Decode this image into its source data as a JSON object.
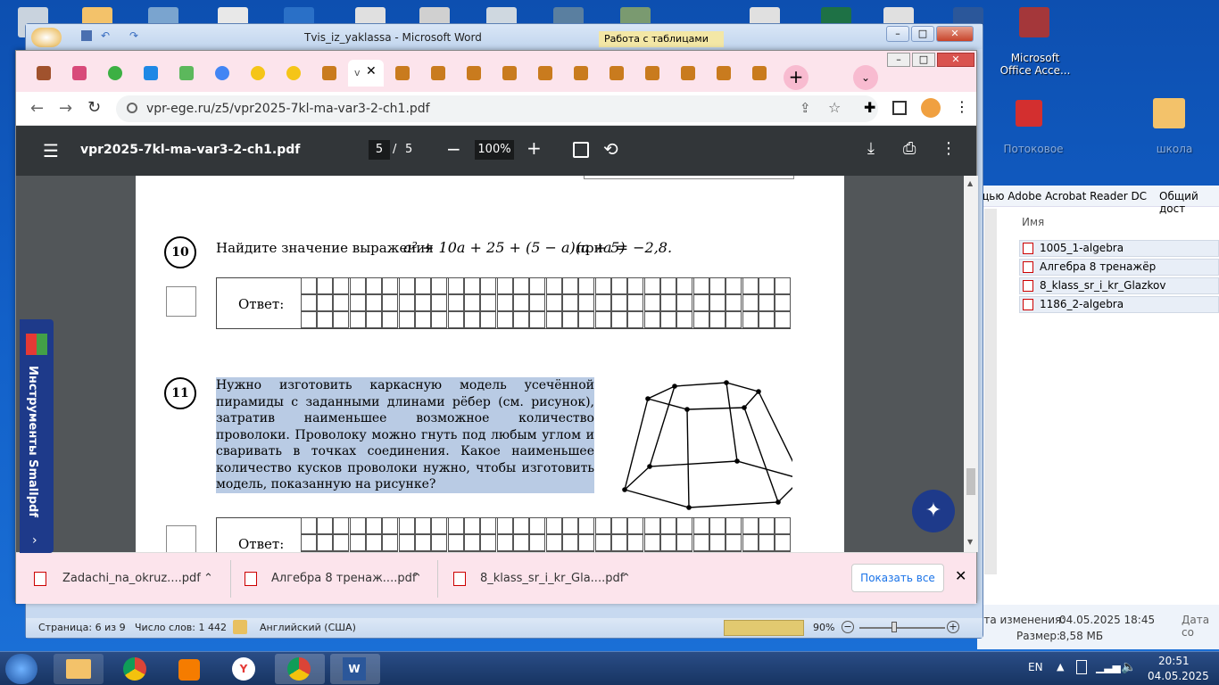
{
  "desktop": {
    "icons": [
      {
        "label": "Microsoft Office Acce..."
      },
      {
        "label": "Потоковое"
      },
      {
        "label": "школа"
      }
    ]
  },
  "word": {
    "title": "Tvis_iz_yaklassa - Microsoft Word",
    "context_tab": "Работа с таблицами",
    "status": {
      "page": "Страница: 6 из 9",
      "words": "Число слов: 1 442",
      "lang": "Английский (США)",
      "zoom": "90%"
    }
  },
  "chrome": {
    "url": "vpr-ege.ru/z5/vpr2025-7kl-ma-var3-2-ch1.pdf",
    "active_tab_label": "v",
    "new_tab": "+",
    "pdf": {
      "filename": "vpr2025-7kl-ma-var3-2-ch1.pdf",
      "page": "5",
      "page_sep": "/",
      "total": "5",
      "zoom": "100%"
    },
    "task10": {
      "number": "10",
      "text": "Найдите значение выражения",
      "expr_html": "a² + 10a + 25 + (5 − a)(a + 5)",
      "cond_pre": "при",
      "cond": "a = −2,8.",
      "answer_label": "Ответ:"
    },
    "task11": {
      "number": "11",
      "text": "Нужно изготовить каркасную модель усечённой пирамиды с заданными длинами рёбер (см. рисунок), затратив наименьшее возможное количество проволоки. Проволоку можно гнуть под любым углом и сваривать в точках соединения. Какое наименьшее количество кусков проволоки нужно, чтобы изготовить модель, показанную на рисунке?",
      "answer_label": "Ответ:"
    },
    "downloads": [
      {
        "name": "Zadachi_na_okruz....pdf"
      },
      {
        "name": "Алгебра 8 тренаж....pdf"
      },
      {
        "name": "8_klass_sr_i_kr_Gla....pdf"
      }
    ],
    "show_all": "Показать все"
  },
  "smallpdf": {
    "label": "Инструменты Smallpdf"
  },
  "explorer": {
    "header_left": "щью Adobe Acrobat Reader DC",
    "header_right": "Общий дост",
    "col_name": "Имя",
    "files": [
      "1005_1-algebra",
      "Алгебра 8 тренажёр",
      "8_klass_sr_i_kr_Glazkov",
      "1186_2-algebra"
    ],
    "modified_label": "ата изменения:",
    "modified_value": "04.05.2025 18:45",
    "size_label": "Размер:",
    "size_value": "8,58 МБ",
    "date_col": "Дата со"
  },
  "taskbar": {
    "lang": "EN",
    "time": "20:51",
    "date": "04.05.2025"
  },
  "colors": {
    "tabstrip": "#fce4ec",
    "pdfbar": "#323639",
    "taskbar": "#1e3f73",
    "smallpdf": "#1e3a8a"
  }
}
